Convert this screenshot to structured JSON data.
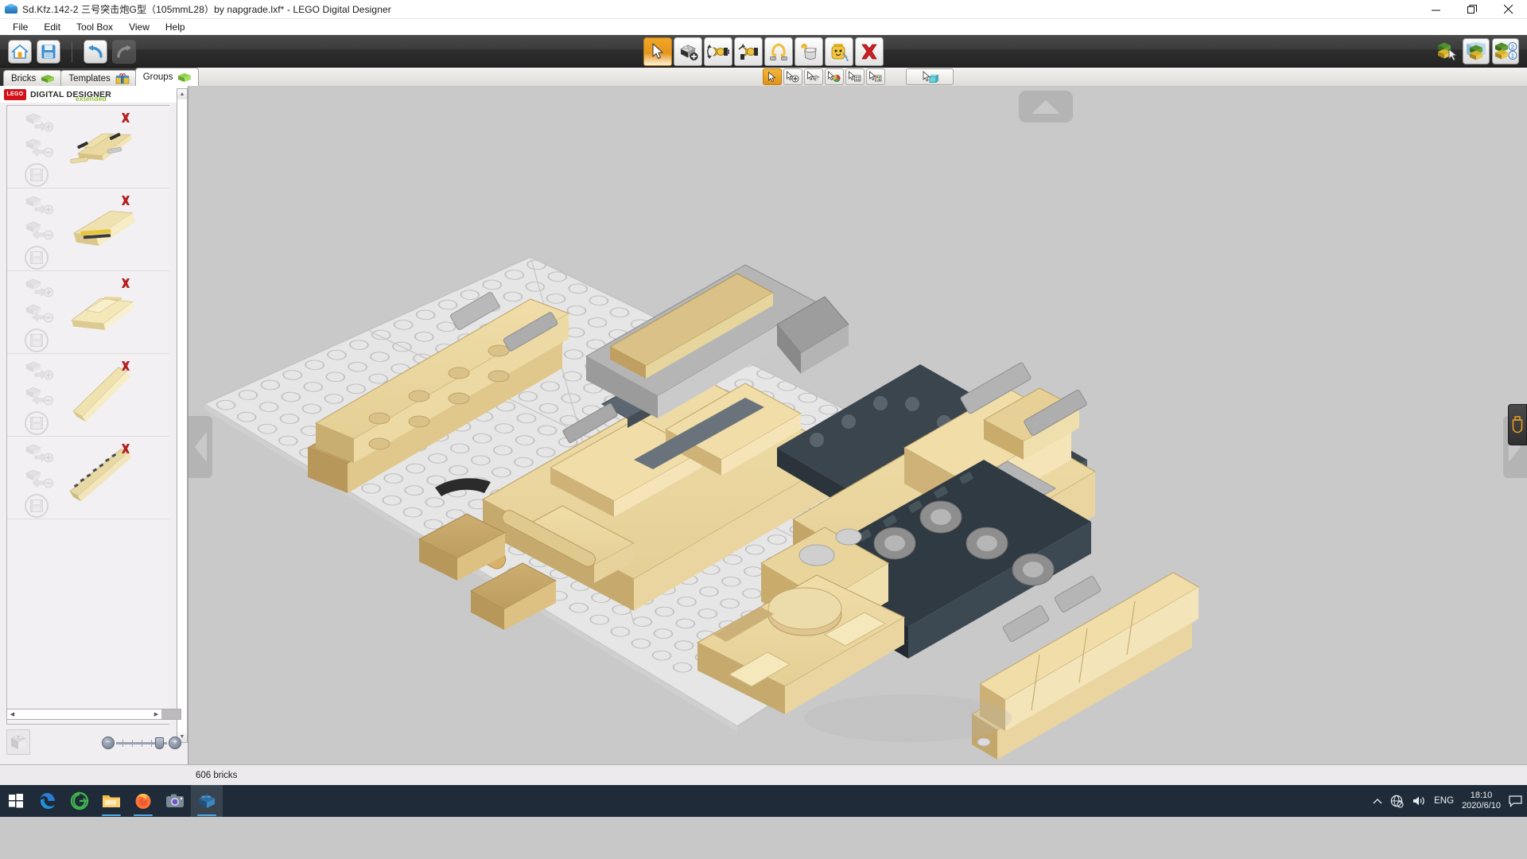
{
  "window": {
    "title": "Sd.Kfz.142-2 三号突击炮G型（105mmL28）by napgrade.lxf* - LEGO Digital Designer",
    "app_icon": "lego-brick-icon",
    "controls": {
      "minimize": "minimize-icon",
      "maximize": "maximize-icon",
      "close": "close-icon"
    }
  },
  "menubar": {
    "items": [
      {
        "label": "File"
      },
      {
        "label": "Edit"
      },
      {
        "label": "Tool Box"
      },
      {
        "label": "View"
      },
      {
        "label": "Help"
      }
    ]
  },
  "toolbar": {
    "left": [
      {
        "name": "home-button",
        "icon": "home-icon",
        "enabled": true
      },
      {
        "name": "save-button",
        "icon": "floppy-disk-icon",
        "enabled": true
      },
      {
        "name": "undo-button",
        "icon": "undo-arrow-icon",
        "enabled": true
      },
      {
        "name": "redo-button",
        "icon": "redo-arrow-icon",
        "enabled": false
      }
    ],
    "center_tools": [
      {
        "name": "select-tool",
        "icon": "cursor-arrow-icon",
        "selected": true
      },
      {
        "name": "clone-tool",
        "icon": "brick-plus-icon",
        "selected": false
      },
      {
        "name": "hinge-tool",
        "icon": "hinge-rotate-icon",
        "selected": false
      },
      {
        "name": "flex-tool",
        "icon": "flex-hinge-icon",
        "selected": false
      },
      {
        "name": "hinge-align-tool",
        "icon": "rope-loop-icon",
        "selected": false
      },
      {
        "name": "paint-tool",
        "icon": "paint-bucket-icon",
        "selected": false
      },
      {
        "name": "decorate-tool",
        "icon": "minifig-decorate-icon",
        "selected": false
      },
      {
        "name": "delete-tool",
        "icon": "red-x-icon",
        "selected": false
      }
    ],
    "modes": [
      {
        "name": "build-mode-button",
        "icon": "build-mode-icon",
        "selected": true
      },
      {
        "name": "view-mode-button",
        "icon": "view-mode-icon",
        "selected": false
      },
      {
        "name": "building-guide-mode-button",
        "icon": "guide-mode-icon",
        "selected": false,
        "badge_top": "2",
        "badge_bottom": "1"
      }
    ]
  },
  "subtoolbar": {
    "tools": [
      {
        "name": "select-single-tool",
        "icon": "cursor-icon",
        "selected": true
      },
      {
        "name": "select-add-tool",
        "icon": "cursor-plus-icon",
        "selected": false
      },
      {
        "name": "select-same-shape-tool",
        "icon": "cursor-shape-icon",
        "selected": false
      },
      {
        "name": "select-same-color-tool",
        "icon": "cursor-color-icon",
        "selected": false
      },
      {
        "name": "select-same-shape-color-tool",
        "icon": "cursor-shape-color-icon",
        "selected": false
      },
      {
        "name": "select-connected-tool",
        "icon": "cursor-connected-icon",
        "selected": false
      }
    ],
    "extra": {
      "name": "select-all-tool",
      "icon": "cursor-box-icon"
    }
  },
  "panel_tabs": [
    {
      "label": "Bricks",
      "icon": "green-brick-icon",
      "selected": false
    },
    {
      "label": "Templates",
      "icon": "template-box-icon",
      "selected": false
    },
    {
      "label": "Groups",
      "icon": "green-group-brick-icon",
      "selected": true
    }
  ],
  "brand": {
    "mark": "LEGO",
    "name": "DIGITAL DESIGNER",
    "edition": "extended",
    "collapse_icon": "collapse-panel-icon"
  },
  "groups_panel": {
    "rows": [
      {
        "name": "group-row-1",
        "thumb": "tank-hull-assembly-thumb",
        "actions": [
          "add-to-group-icon",
          "remove-from-group-icon",
          "save-group-icon"
        ],
        "delete": "delete-group-icon"
      },
      {
        "name": "group-row-2",
        "thumb": "tank-superstructure-thumb",
        "actions": [
          "add-to-group-icon",
          "remove-from-group-icon",
          "save-group-icon"
        ],
        "delete": "delete-group-icon"
      },
      {
        "name": "group-row-3",
        "thumb": "tank-casemate-thumb",
        "actions": [
          "add-to-group-icon",
          "remove-from-group-icon",
          "save-group-icon"
        ],
        "delete": "delete-group-icon"
      },
      {
        "name": "group-row-4",
        "thumb": "side-skirt-panel-thumb",
        "actions": [
          "add-to-group-icon",
          "remove-from-group-icon",
          "save-group-icon"
        ],
        "delete": "delete-group-icon"
      },
      {
        "name": "group-row-5",
        "thumb": "track-link-run-thumb",
        "actions": [
          "add-to-group-icon",
          "remove-from-group-icon",
          "save-group-icon"
        ],
        "delete": "delete-group-icon"
      }
    ],
    "scroll_up": "scroll-up-icon",
    "scroll_down": "scroll-down-icon",
    "scroll_left": "scroll-left-icon",
    "scroll_right": "scroll-right-icon"
  },
  "panel_footer": {
    "preview_icon": "brick-preview-icon",
    "zoom_out": "zoom-out-icon",
    "zoom_in": "zoom-in-icon"
  },
  "viewport": {
    "nav_up": "rotate-up-arrow",
    "nav_left": "rotate-left-arrow",
    "nav_right": "rotate-right-arrow",
    "side_tab_icon": "usb-drive-icon",
    "model_description": "Tan and dark-tan LEGO StuG III Ausf. G assault gun, exploded into sub-assemblies on a light grey baseplate"
  },
  "statusbar": {
    "brick_count": "606 bricks"
  },
  "taskbar": {
    "start": "windows-start-icon",
    "items": [
      {
        "name": "taskbar-edge",
        "icon": "edge-browser-icon",
        "running": false,
        "active": false
      },
      {
        "name": "taskbar-360-browser",
        "icon": "360-browser-icon",
        "running": false,
        "active": false
      },
      {
        "name": "taskbar-file-explorer",
        "icon": "file-explorer-icon",
        "running": true,
        "active": false
      },
      {
        "name": "taskbar-firefox",
        "icon": "firefox-icon",
        "running": true,
        "active": false
      },
      {
        "name": "taskbar-camera",
        "icon": "camera-icon",
        "running": false,
        "active": false
      },
      {
        "name": "taskbar-lego-digital-designer",
        "icon": "lego-brick-icon",
        "running": true,
        "active": true
      }
    ],
    "tray": {
      "overflow": "chevron-up-icon",
      "network": "network-disconnected-icon",
      "volume": "speaker-icon",
      "language": "ENG",
      "time": "18:10",
      "date": "2020/6/10",
      "action_center": "notification-icon"
    }
  },
  "colors": {
    "accent_orange": "#e5951b",
    "brick_tan": "#dcc189",
    "brick_dark_tan": "#c9a969",
    "brick_grey": "#a7a7a7",
    "track_dark": "#2f3a42",
    "baseplate": "#e2e2e2",
    "viewport_bg": "#c9c9c9",
    "taskbar_bg": "#1f2b38",
    "lego_red": "#d3131b",
    "delete_red": "#b42020"
  }
}
